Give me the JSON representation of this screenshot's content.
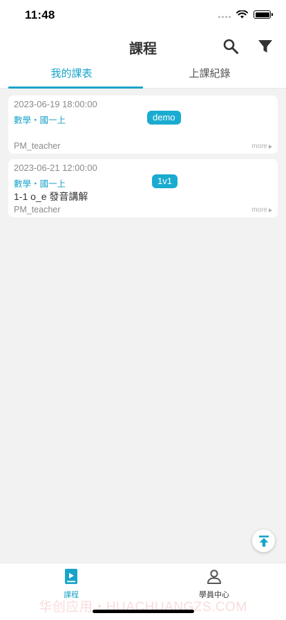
{
  "status_bar": {
    "time": "11:48"
  },
  "navbar": {
    "title": "課程",
    "search_icon": "search-icon",
    "filter_icon": "filter-icon"
  },
  "tabs": [
    {
      "label": "我的課表",
      "active": true
    },
    {
      "label": "上課紀錄",
      "active": false
    }
  ],
  "courses": [
    {
      "datetime": "2023-06-19 18:00:00",
      "subject": "數學・國一上",
      "badge": "demo",
      "lesson": "",
      "teacher": "PM_teacher",
      "more": "more"
    },
    {
      "datetime": "2023-06-21 12:00:00",
      "subject": "數學・國一上",
      "badge": "1v1",
      "lesson": "1-1 o_e 發音講解",
      "teacher": "PM_teacher",
      "more": "more"
    }
  ],
  "bottom_tabs": [
    {
      "label": "課程",
      "icon": "course-book-icon",
      "active": true
    },
    {
      "label": "學員中心",
      "icon": "person-icon",
      "active": false
    }
  ],
  "watermark": "华创应用・HUACHUANGZS.COM",
  "colors": {
    "accent": "#1aa3c9",
    "badge": "#1aabd0",
    "background": "#f2f2f2"
  }
}
